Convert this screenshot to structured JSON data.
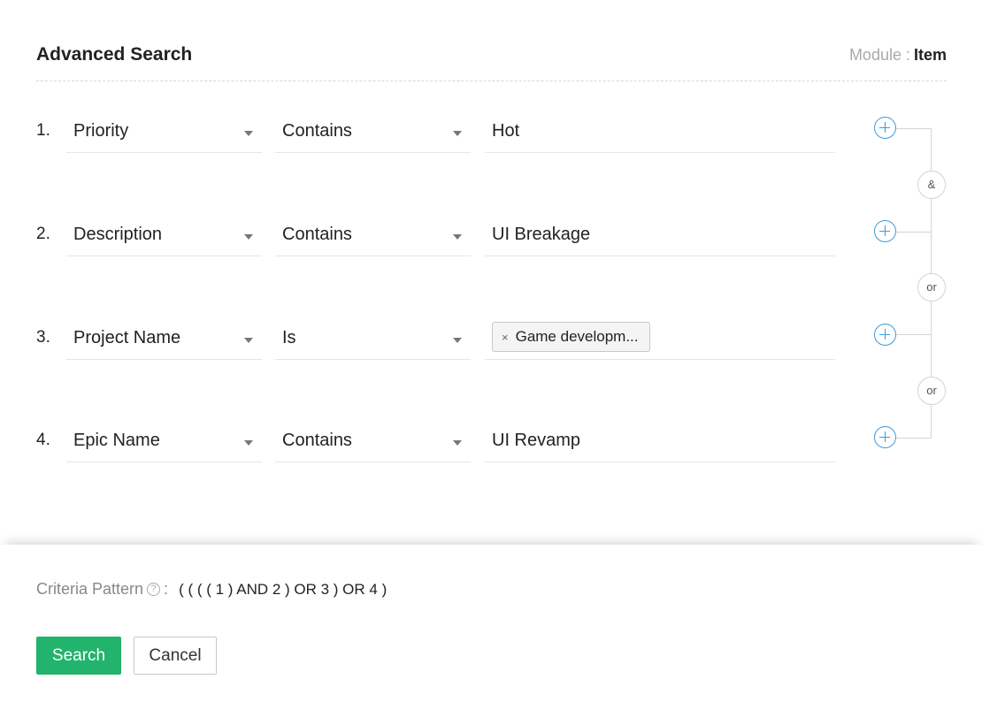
{
  "header": {
    "title": "Advanced Search",
    "module_label": "Module :",
    "module_value": "Item"
  },
  "rows": [
    {
      "num": "1.",
      "field": "Priority",
      "operator": "Contains",
      "value": "Hot"
    },
    {
      "num": "2.",
      "field": "Description",
      "operator": "Contains",
      "value": "UI Breakage"
    },
    {
      "num": "3.",
      "field": "Project Name",
      "operator": "Is",
      "chip": {
        "remove": "×",
        "label": "Game developm..."
      }
    },
    {
      "num": "4.",
      "field": "Epic Name",
      "operator": "Contains",
      "value": "UI Revamp"
    }
  ],
  "connectors": [
    "&",
    "or",
    "or"
  ],
  "footer": {
    "criteria_label": "Criteria Pattern",
    "help_glyph": "?",
    "colon": ":",
    "pattern": "( ( ( ( 1 ) AND 2 ) OR 3 ) OR 4 )",
    "search_label": "Search",
    "cancel_label": "Cancel"
  },
  "colors": {
    "accent_blue": "#3a9be0",
    "search_green": "#22b36d"
  },
  "icons": {
    "add": "plus-circle-icon",
    "dropdown": "caret-down-icon",
    "help": "question-circle-icon",
    "remove": "close-icon"
  }
}
